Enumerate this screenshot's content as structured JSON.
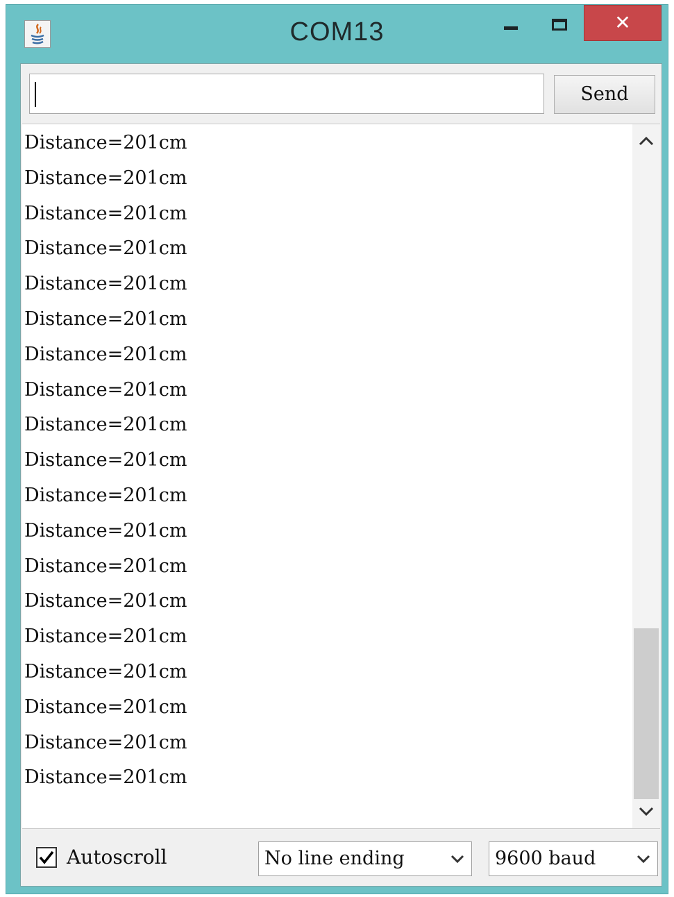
{
  "window": {
    "title": "COM13",
    "close_symbol": "✕"
  },
  "send_row": {
    "input_value": "",
    "send_label": "Send"
  },
  "output": {
    "lines": [
      "Distance=201cm",
      "Distance=201cm",
      "Distance=201cm",
      "Distance=201cm",
      "Distance=201cm",
      "Distance=201cm",
      "Distance=201cm",
      "Distance=201cm",
      "Distance=201cm",
      "Distance=201cm",
      "Distance=201cm",
      "Distance=201cm",
      "Distance=201cm",
      "Distance=201cm",
      "Distance=201cm",
      "Distance=201cm",
      "Distance=201cm",
      "Distance=201cm",
      "Distance=201cm"
    ],
    "scroll_position": 0.75
  },
  "footer": {
    "autoscroll_label": "Autoscroll",
    "autoscroll_checked": true,
    "line_ending_selected": "No line ending",
    "baud_selected": "9600 baud"
  },
  "icons": {
    "app": "java-icon",
    "minimize": "minimize-icon",
    "maximize": "maximize-icon",
    "close": "close-icon",
    "scroll_up": "chevron-up-icon",
    "scroll_down": "chevron-down-icon",
    "check": "checkmark-icon",
    "dropdown": "chevron-down-icon"
  },
  "colors": {
    "titlebar": "#6cc2c6",
    "close": "#c8474a"
  }
}
